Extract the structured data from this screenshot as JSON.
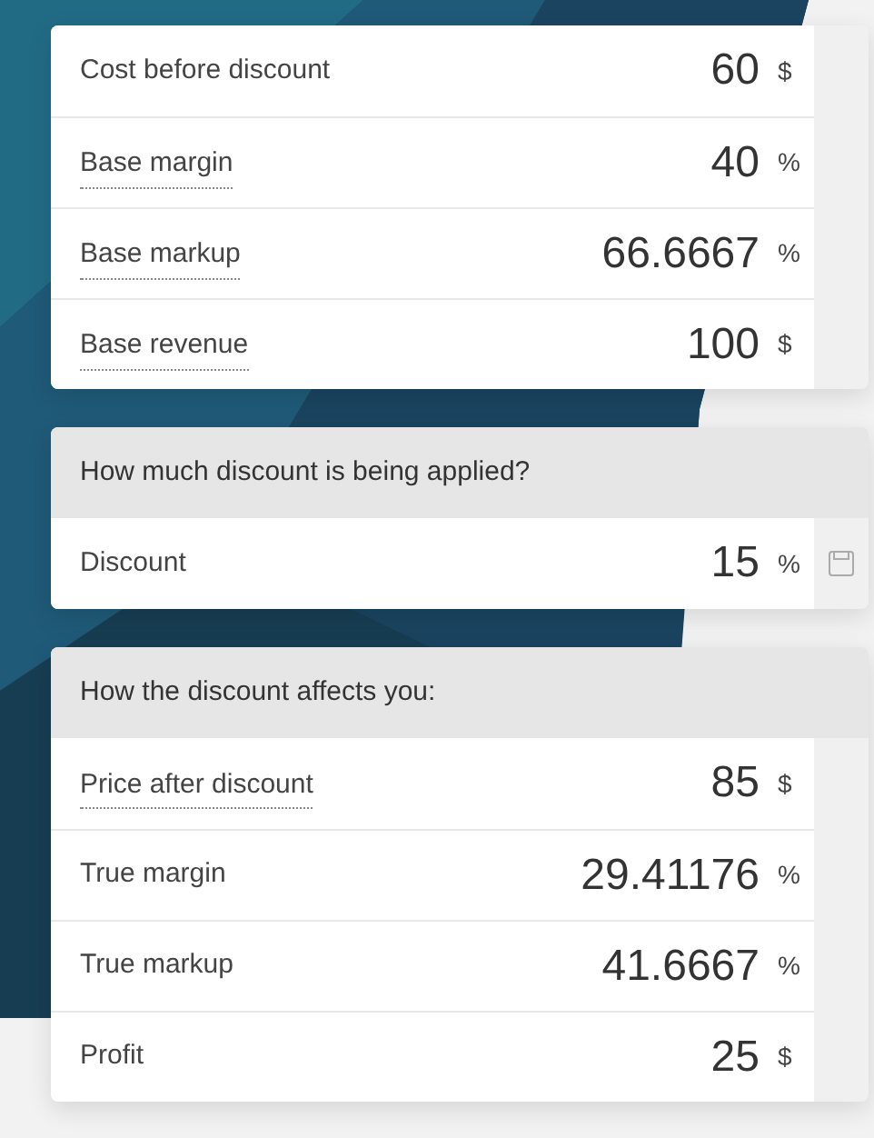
{
  "sections": [
    {
      "rows": [
        {
          "label": "Cost before discount",
          "underlined": false,
          "value": "60",
          "unit": "$",
          "kind": "output"
        },
        {
          "label": "Base margin",
          "underlined": true,
          "value": "40",
          "unit": "%",
          "kind": "output"
        },
        {
          "label": "Base markup",
          "underlined": true,
          "value": "66.6667",
          "unit": "%",
          "kind": "output"
        },
        {
          "label": "Base revenue",
          "underlined": true,
          "value": "100",
          "unit": "$",
          "kind": "output"
        }
      ]
    },
    {
      "header": "How much discount is being applied?",
      "rows": [
        {
          "label": "Discount",
          "underlined": false,
          "value": "15",
          "unit": "%",
          "kind": "input"
        }
      ]
    },
    {
      "header": "How the discount affects you:",
      "rows": [
        {
          "label": "Price after discount",
          "underlined": true,
          "value": "85",
          "unit": "$",
          "kind": "output"
        },
        {
          "label": "True margin",
          "underlined": false,
          "value": "29.41176",
          "unit": "%",
          "kind": "output"
        },
        {
          "label": "True markup",
          "underlined": false,
          "value": "41.6667",
          "unit": "%",
          "kind": "output"
        },
        {
          "label": "Profit",
          "underlined": false,
          "value": "25",
          "unit": "$",
          "kind": "output"
        }
      ]
    }
  ]
}
